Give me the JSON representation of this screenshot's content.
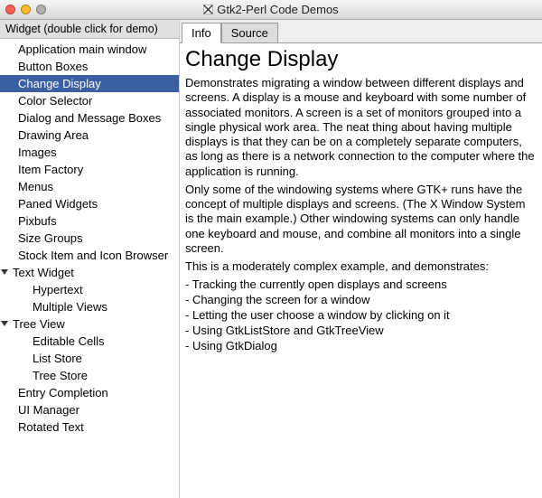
{
  "window": {
    "title": "Gtk2-Perl Code Demos"
  },
  "sidebar": {
    "header": "Widget (double click for demo)",
    "items": [
      {
        "label": "Application main window",
        "level": 0,
        "selected": false,
        "expander": null
      },
      {
        "label": "Button Boxes",
        "level": 0,
        "selected": false,
        "expander": null
      },
      {
        "label": "Change Display",
        "level": 0,
        "selected": true,
        "expander": null
      },
      {
        "label": "Color Selector",
        "level": 0,
        "selected": false,
        "expander": null
      },
      {
        "label": "Dialog and Message Boxes",
        "level": 0,
        "selected": false,
        "expander": null
      },
      {
        "label": "Drawing Area",
        "level": 0,
        "selected": false,
        "expander": null
      },
      {
        "label": "Images",
        "level": 0,
        "selected": false,
        "expander": null
      },
      {
        "label": "Item Factory",
        "level": 0,
        "selected": false,
        "expander": null
      },
      {
        "label": "Menus",
        "level": 0,
        "selected": false,
        "expander": null
      },
      {
        "label": "Paned Widgets",
        "level": 0,
        "selected": false,
        "expander": null
      },
      {
        "label": "Pixbufs",
        "level": 0,
        "selected": false,
        "expander": null
      },
      {
        "label": "Size Groups",
        "level": 0,
        "selected": false,
        "expander": null
      },
      {
        "label": "Stock Item and Icon Browser",
        "level": 0,
        "selected": false,
        "expander": null
      },
      {
        "label": "Text Widget",
        "level": 0,
        "selected": false,
        "expander": "open"
      },
      {
        "label": "Hypertext",
        "level": 1,
        "selected": false,
        "expander": null
      },
      {
        "label": "Multiple Views",
        "level": 1,
        "selected": false,
        "expander": null
      },
      {
        "label": "Tree View",
        "level": 0,
        "selected": false,
        "expander": "open"
      },
      {
        "label": "Editable Cells",
        "level": 1,
        "selected": false,
        "expander": null
      },
      {
        "label": "List Store",
        "level": 1,
        "selected": false,
        "expander": null
      },
      {
        "label": "Tree Store",
        "level": 1,
        "selected": false,
        "expander": null
      },
      {
        "label": "Entry Completion",
        "level": 0,
        "selected": false,
        "expander": null
      },
      {
        "label": "UI Manager",
        "level": 0,
        "selected": false,
        "expander": null
      },
      {
        "label": "Rotated Text",
        "level": 0,
        "selected": false,
        "expander": null
      }
    ]
  },
  "tabs": [
    {
      "label": "Info",
      "active": true
    },
    {
      "label": "Source",
      "active": false
    }
  ],
  "info": {
    "title": "Change Display",
    "paragraphs": [
      "Demonstrates migrating a window between different displays and screens. A display is a mouse and keyboard with some number of associated monitors. A screen is a set of monitors grouped into a single physical work area. The neat thing about having multiple displays is that they can be on a completely separate computers, as long as there is a network connection to the computer where the application is running.",
      "Only some of the windowing systems where GTK+ runs have the concept of multiple displays and screens. (The X Window System is the main example.) Other windowing systems can only handle one keyboard and mouse, and combine all monitors into a single screen.",
      "This is a moderately complex example, and demonstrates:"
    ],
    "bullets": [
      "- Tracking the currently open displays and screens",
      "- Changing the screen for a window",
      "- Letting the user choose a window by clicking on it",
      "- Using GtkListStore and GtkTreeView",
      "- Using GtkDialog"
    ]
  }
}
